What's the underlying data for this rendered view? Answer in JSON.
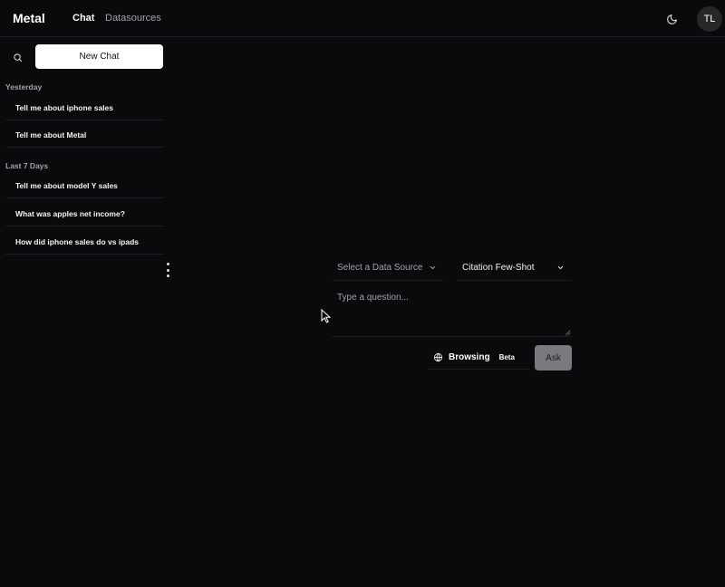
{
  "header": {
    "logo": "Metal",
    "nav": [
      {
        "label": "Chat",
        "active": true
      },
      {
        "label": "Datasources",
        "active": false
      }
    ],
    "theme_icon": "moon-icon",
    "avatar_initials": "TL"
  },
  "sidebar": {
    "search_icon": "search-icon",
    "new_chat_label": "New Chat",
    "sections": [
      {
        "label": "Yesterday",
        "items": [
          "Tell me about iphone sales",
          "Tell me about Metal"
        ]
      },
      {
        "label": "Last 7 Days",
        "items": [
          "Tell me about model Y sales",
          "What was apples net income?",
          "How did iphone sales do vs ipads"
        ]
      }
    ],
    "more_icon": "kebab-vertical-icon"
  },
  "main": {
    "data_source_select": {
      "value": "Select a Data Source"
    },
    "mode_select": {
      "value": "Citation Few-Shot"
    },
    "question": {
      "placeholder": "Type a question...",
      "value": ""
    },
    "browsing": {
      "label": "Browsing",
      "badge": "Beta",
      "icon": "globe-icon"
    },
    "ask_label": "Ask"
  },
  "colors": {
    "background": "#0a0a0c",
    "primary_button": "#ffffff",
    "ask_button_disabled": "#7a7a7e",
    "muted_text": "#a1a1aa"
  }
}
